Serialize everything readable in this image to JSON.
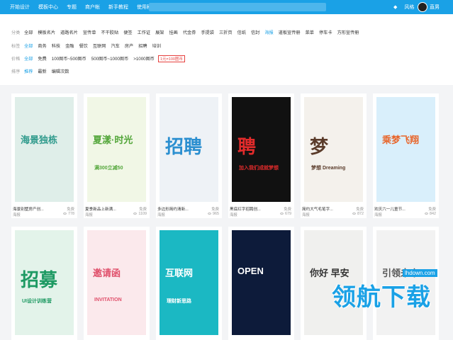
{
  "topbar": {
    "nav": [
      "开始设计",
      "模板中心",
      "专题",
      "商户帐",
      "新手教程",
      "使用秘籍"
    ],
    "right": [
      "风格"
    ],
    "user": "直男"
  },
  "filters": {
    "category": {
      "label": "分类",
      "items": [
        "全部",
        "模板名片",
        "道路名片",
        "宣传单",
        "不干胶贴",
        "便签",
        "工作证",
        "展架",
        "挂画",
        "代金券",
        "手提袋",
        "三折页",
        "信纸",
        "信封",
        "海报",
        "道板宣传册",
        "菜单",
        "停车卡",
        "方形宣传册"
      ],
      "selected": 14
    },
    "tags": {
      "label": "标签",
      "items": [
        "全部",
        "商务",
        "科技",
        "金融",
        "餐饮",
        "互联网",
        "汽车",
        "房产",
        "招聘",
        "培训"
      ],
      "selected": 0
    },
    "price": {
      "label": "价格",
      "items": [
        "全部",
        "免费",
        "100图币~500图币",
        "500图币~1000图币",
        ">1000图币"
      ],
      "selected": 0,
      "badge": "1元=100图币"
    },
    "sort": {
      "label": "排序",
      "items": [
        "推荐",
        "最新",
        "编辑次数"
      ],
      "selected": 0
    }
  },
  "cards": [
    {
      "title": "海景别墅房产创...",
      "fee": "免费",
      "cat": "海报",
      "views": "778",
      "poster": "海景独栋",
      "bg": "#dfeee9",
      "fg": "#2f9a8c"
    },
    {
      "title": "夏季新品上新满...",
      "fee": "免费",
      "cat": "海报",
      "views": "1109",
      "poster": "夏漾·时光",
      "sub": "满300立减50",
      "bg": "#f1f7e6",
      "fg": "#53a63a"
    },
    {
      "title": "多边形简约清新...",
      "fee": "免费",
      "cat": "海报",
      "views": "965",
      "poster": "招聘",
      "bg": "#eef2f6",
      "fg": "#2b8fd0"
    },
    {
      "title": "黑底红字招聘创...",
      "fee": "免费",
      "cat": "海报",
      "views": "679",
      "poster": "聘",
      "sub": "加入我们成就梦想",
      "bg": "#111111",
      "fg": "#e12b2b"
    },
    {
      "title": "简约大气毛笔字...",
      "fee": "免费",
      "cat": "海报",
      "views": "872",
      "poster": "梦",
      "sub": "梦想 Dreaming",
      "bg": "#f4f1ec",
      "fg": "#5a3b2a"
    },
    {
      "title": "欢庆六一儿童节...",
      "fee": "免费",
      "cat": "海报",
      "views": "842",
      "poster": "乘梦飞翔",
      "bg": "#d9effb",
      "fg": "#e8652a"
    },
    {
      "title": "",
      "poster": "招募",
      "sub": "UI设计训练营",
      "bg": "#e3f3ea",
      "fg": "#1e9a63"
    },
    {
      "title": "",
      "poster": "邀请函",
      "sub": "INVITATION",
      "bg": "#fbe9ec",
      "fg": "#e0506b"
    },
    {
      "title": "",
      "poster": "互联网",
      "sub": "理财新思路",
      "bg": "#1bb8c3",
      "fg": "#ffffff"
    },
    {
      "title": "",
      "poster": "OPEN",
      "bg": "#0d1b3a",
      "fg": "#ffffff"
    },
    {
      "title": "",
      "poster": "你好 早安",
      "bg": "#f0f0ee",
      "fg": "#333333"
    },
    {
      "title": "",
      "poster": "引领未来",
      "bg": "#f2f2f2",
      "fg": "#555555"
    }
  ],
  "watermark": {
    "site": "lhdown.com",
    "text": "领航下载"
  }
}
